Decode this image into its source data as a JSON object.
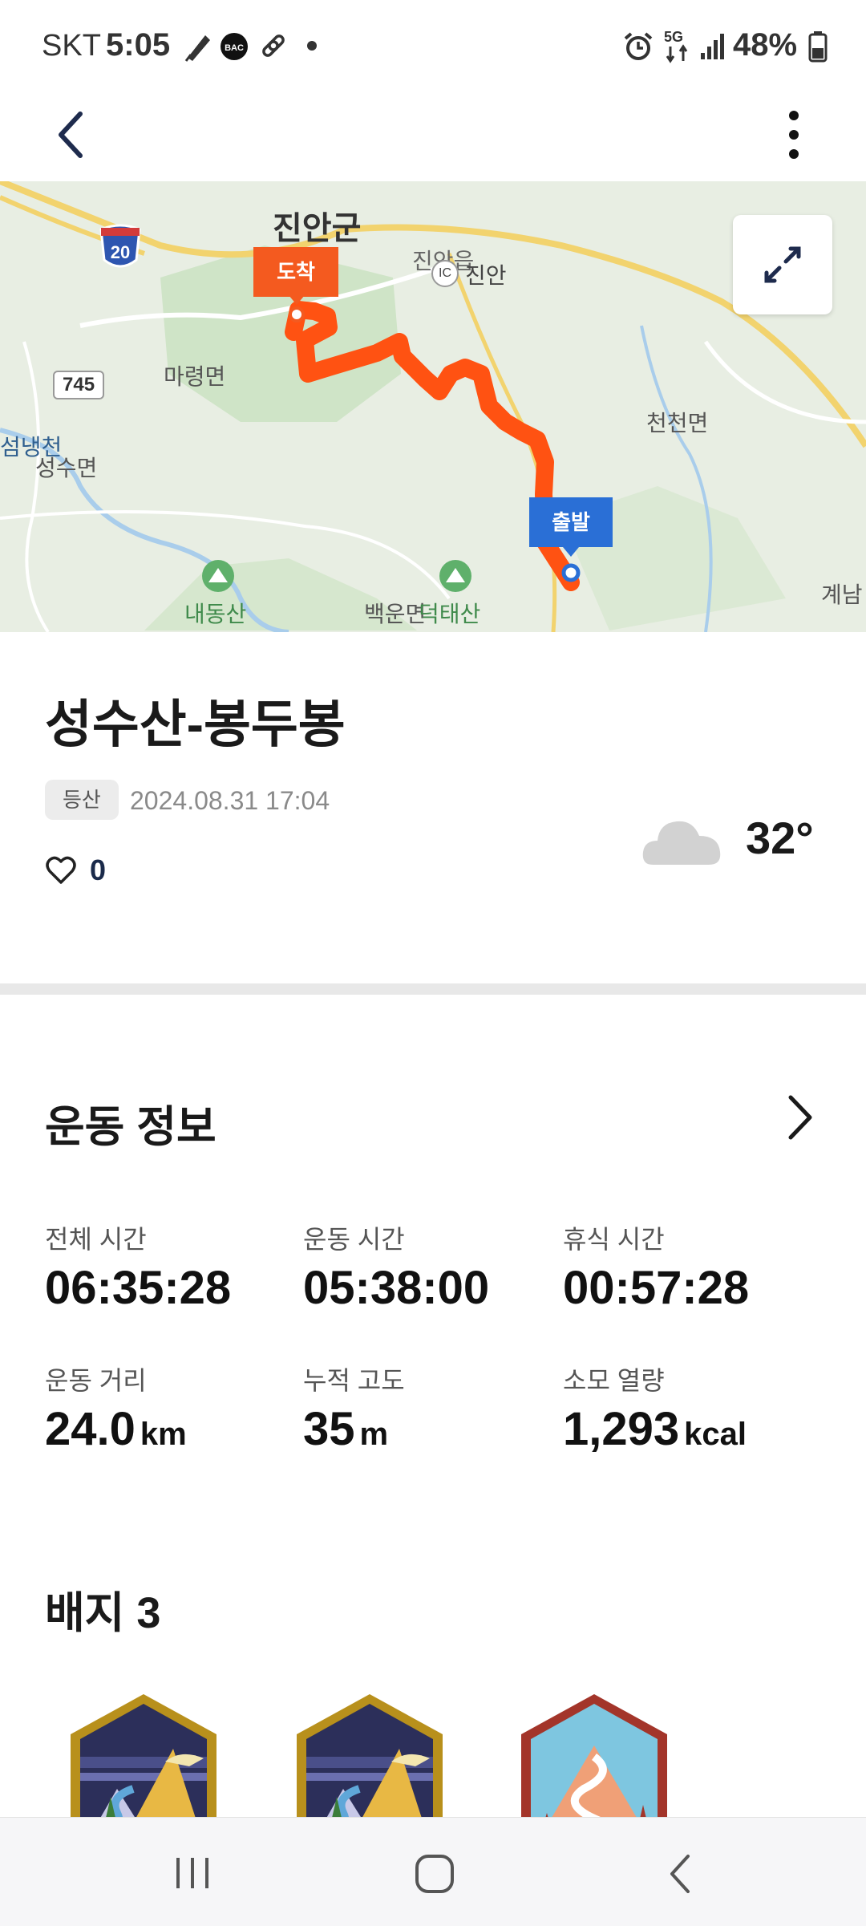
{
  "status_bar": {
    "carrier": "SKT",
    "time": "5:05",
    "icons": [
      "notification-pen-icon",
      "bac-icon",
      "link-icon",
      "dot-icon",
      "alarm-icon",
      "5g-icon",
      "signal-icon",
      "battery-icon"
    ],
    "network": "5G",
    "battery": "48%"
  },
  "app_bar": {
    "back_icon": "chevron-left-icon",
    "menu_icon": "more-vertical-icon"
  },
  "map": {
    "labels": {
      "county": "진안군",
      "town": "진안읍",
      "ic_badge": "IC",
      "ic_name": "진안",
      "highway_shield": "20",
      "road_shield": "745",
      "maryeong": "마령면",
      "cheoncheon": "천천면",
      "seongsu": "성수면",
      "stream": "섬냉천",
      "gyenam": "계남",
      "naedongsan": "내동산",
      "baegun": "백운면",
      "deoktaesan": "덕태산"
    },
    "end_pin": "도착",
    "start_pin": "출발",
    "route_color": "#ff5212",
    "expand_icon": "expand-arrows-icon"
  },
  "activity": {
    "title": "성수산-봉두봉",
    "tag": "등산",
    "datetime": "2024.08.31 17:04",
    "like_count": "0",
    "like_icon": "heart-outline-icon",
    "weather_icon": "cloud-icon",
    "temperature": "32°"
  },
  "exercise_info": {
    "title": "운동 정보",
    "stats": [
      {
        "label": "전체 시간",
        "value": "06:35:28",
        "unit": ""
      },
      {
        "label": "운동 시간",
        "value": "05:38:00",
        "unit": ""
      },
      {
        "label": "휴식 시간",
        "value": "00:57:28",
        "unit": ""
      },
      {
        "label": "운동 거리",
        "value": "24.0",
        "unit": "km"
      },
      {
        "label": "누적 고도",
        "value": "35",
        "unit": "m"
      },
      {
        "label": "소모 열량",
        "value": "1,293",
        "unit": "kcal"
      }
    ]
  },
  "badges": {
    "title": "배지 3",
    "items": [
      "mountain-sunset-badge",
      "mountain-sunset-badge",
      "trail-path-badge"
    ]
  },
  "nav_bar": {
    "recents_icon": "recents-icon",
    "home_icon": "home-icon",
    "back_icon": "nav-back-icon"
  }
}
